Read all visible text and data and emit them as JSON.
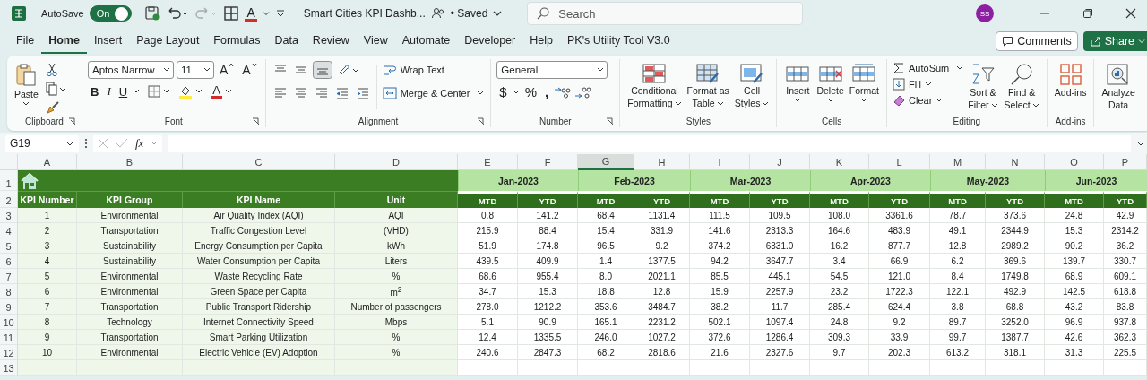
{
  "title_bar": {
    "autosave_label": "AutoSave",
    "autosave_on": true,
    "toggle_text": "On",
    "file_title": "Smart Cities KPI Dashb...",
    "save_status": "• Saved",
    "font_color": "A",
    "search_placeholder": "Search",
    "avatar": "SS"
  },
  "menu_tabs": [
    {
      "label": "File",
      "selected": false
    },
    {
      "label": "Home",
      "selected": true
    },
    {
      "label": "Insert",
      "selected": false
    },
    {
      "label": "Page Layout",
      "selected": false
    },
    {
      "label": "Formulas",
      "selected": false
    },
    {
      "label": "Data",
      "selected": false
    },
    {
      "label": "Review",
      "selected": false
    },
    {
      "label": "View",
      "selected": false
    },
    {
      "label": "Automate",
      "selected": false
    },
    {
      "label": "Developer",
      "selected": false
    },
    {
      "label": "Help",
      "selected": false
    },
    {
      "label": "PK's Utility Tool V3.0",
      "selected": false
    }
  ],
  "comments_button": "Comments",
  "share_button": "Share",
  "ribbon": {
    "clipboard": {
      "title": "Clipboard",
      "paste": "Paste"
    },
    "font": {
      "title": "Font",
      "font_name": "Aptos Narrow",
      "font_size": "11",
      "grow": "A",
      "shrink": "A",
      "bold": "B",
      "italic": "I",
      "underline": "U",
      "font_color": "A"
    },
    "alignment": {
      "title": "Alignment",
      "bottom_align_selected": true,
      "wrap_text": "Wrap Text",
      "merge_center": "Merge & Center"
    },
    "number": {
      "title": "Number",
      "format": "General",
      "currency": "$",
      "percent": "%",
      "comma": ","
    },
    "styles": {
      "title": "Styles",
      "buttons": [
        {
          "line1": "Conditional",
          "line2": "Formatting"
        },
        {
          "line1": "Format as",
          "line2": "Table"
        },
        {
          "line1": "Cell",
          "line2": "Styles"
        }
      ]
    },
    "cells": {
      "title": "Cells",
      "buttons": [
        "Insert",
        "Delete",
        "Format"
      ]
    },
    "editing": {
      "title": "Editing",
      "autosum": "AutoSum",
      "fill": "Fill",
      "clear": "Clear",
      "sort": {
        "line1": "Sort &",
        "line2": "Filter"
      },
      "find": {
        "line1": "Find &",
        "line2": "Select"
      }
    },
    "addins": {
      "title": "Add-ins",
      "button": "Add-ins"
    },
    "analyze": {
      "line1": "Analyze",
      "line2": "Data"
    }
  },
  "formula_bar": {
    "name_box": "G19",
    "fx": "fx"
  },
  "sheet": {
    "column_letters": [
      {
        "label": "A",
        "selected": false
      },
      {
        "label": "B",
        "selected": false
      },
      {
        "label": "C",
        "selected": false
      },
      {
        "label": "D",
        "selected": false
      },
      {
        "label": "E",
        "selected": false
      },
      {
        "label": "F",
        "selected": false
      },
      {
        "label": "G",
        "selected": true
      },
      {
        "label": "H",
        "selected": false
      },
      {
        "label": "I",
        "selected": false
      },
      {
        "label": "J",
        "selected": false
      },
      {
        "label": "K",
        "selected": false
      },
      {
        "label": "L",
        "selected": false
      },
      {
        "label": "M",
        "selected": false
      },
      {
        "label": "N",
        "selected": false
      },
      {
        "label": "O",
        "selected": false
      },
      {
        "label": "P",
        "selected": false
      }
    ],
    "row_numbers": [
      "1",
      "2",
      "3",
      "4",
      "5",
      "6",
      "7",
      "8",
      "9",
      "10",
      "11",
      "12",
      "13"
    ]
  },
  "table": {
    "headers": [
      "KPI Number",
      "KPI Group",
      "KPI Name",
      "Unit"
    ],
    "months": [
      {
        "label": "Jan-2023",
        "columns": [
          "MTD",
          "YTD"
        ]
      },
      {
        "label": "Feb-2023",
        "columns": [
          "MTD",
          "YTD"
        ]
      },
      {
        "label": "Mar-2023",
        "columns": [
          "MTD",
          "YTD"
        ]
      },
      {
        "label": "Apr-2023",
        "columns": [
          "MTD",
          "YTD"
        ]
      },
      {
        "label": "May-2023",
        "columns": [
          "MTD",
          "YTD"
        ]
      },
      {
        "label": "Jun-2023",
        "columns": [
          "MTD",
          "YTD"
        ]
      }
    ],
    "rows": [
      {
        "cells": [
          "1",
          "Environmental",
          "Air Quality Index (AQI)",
          "AQI"
        ],
        "values": [
          "0.8",
          "141.2",
          "68.4",
          "1131.4",
          "111.5",
          "109.5",
          "108.0",
          "3361.6",
          "78.7",
          "373.6",
          "24.8",
          "42.9"
        ]
      },
      {
        "cells": [
          "2",
          "Transportation",
          "Traffic Congestion Level",
          "(VHD)"
        ],
        "values": [
          "215.9",
          "88.4",
          "15.4",
          "331.9",
          "141.6",
          "2313.3",
          "164.6",
          "483.9",
          "49.1",
          "2344.9",
          "15.3",
          "2314.2"
        ]
      },
      {
        "cells": [
          "3",
          "Sustainability",
          "Energy Consumption per Capita",
          "kWh"
        ],
        "values": [
          "51.9",
          "174.8",
          "96.5",
          "9.2",
          "374.2",
          "6331.0",
          "16.2",
          "877.7",
          "12.8",
          "2989.2",
          "90.2",
          "36.2"
        ]
      },
      {
        "cells": [
          "4",
          "Sustainability",
          "Water Consumption per Capita",
          "Liters"
        ],
        "values": [
          "439.5",
          "409.9",
          "1.4",
          "1377.5",
          "94.2",
          "3647.7",
          "3.4",
          "66.9",
          "6.2",
          "369.6",
          "139.7",
          "330.7"
        ]
      },
      {
        "cells": [
          "5",
          "Environmental",
          "Waste Recycling Rate",
          "%"
        ],
        "values": [
          "68.6",
          "955.4",
          "8.0",
          "2021.1",
          "85.5",
          "445.1",
          "54.5",
          "121.0",
          "8.4",
          "1749.8",
          "68.9",
          "609.1"
        ]
      },
      {
        "cells": [
          "6",
          "Environmental",
          "Green Space per Capita",
          "m$^{2}$"
        ],
        "values": [
          "34.7",
          "15.3",
          "18.8",
          "12.8",
          "15.9",
          "2257.9",
          "23.2",
          "1722.3",
          "122.1",
          "492.9",
          "142.5",
          "618.8"
        ]
      },
      {
        "cells": [
          "7",
          "Transportation",
          "Public Transport Ridership",
          "Number of passengers"
        ],
        "values": [
          "278.0",
          "1212.2",
          "353.6",
          "3484.7",
          "38.2",
          "11.7",
          "285.4",
          "624.4",
          "3.8",
          "68.8",
          "43.2",
          "83.8"
        ]
      },
      {
        "cells": [
          "8",
          "Technology",
          "Internet Connectivity Speed",
          "Mbps"
        ],
        "values": [
          "5.1",
          "90.9",
          "165.1",
          "2231.2",
          "502.1",
          "1097.4",
          "24.8",
          "9.2",
          "89.7",
          "3252.0",
          "96.9",
          "937.8"
        ]
      },
      {
        "cells": [
          "9",
          "Transportation",
          "Smart Parking Utilization",
          "%"
        ],
        "values": [
          "12.4",
          "1335.5",
          "246.0",
          "1027.2",
          "372.6",
          "1286.4",
          "309.3",
          "33.9",
          "99.7",
          "1387.7",
          "42.6",
          "362.3"
        ]
      },
      {
        "cells": [
          "10",
          "Environmental",
          "Electric Vehicle (EV) Adoption",
          "%"
        ],
        "values": [
          "240.6",
          "2847.3",
          "68.2",
          "2818.6",
          "21.6",
          "2327.6",
          "9.7",
          "202.3",
          "613.2",
          "318.1",
          "31.3",
          "225.5"
        ]
      }
    ]
  }
}
